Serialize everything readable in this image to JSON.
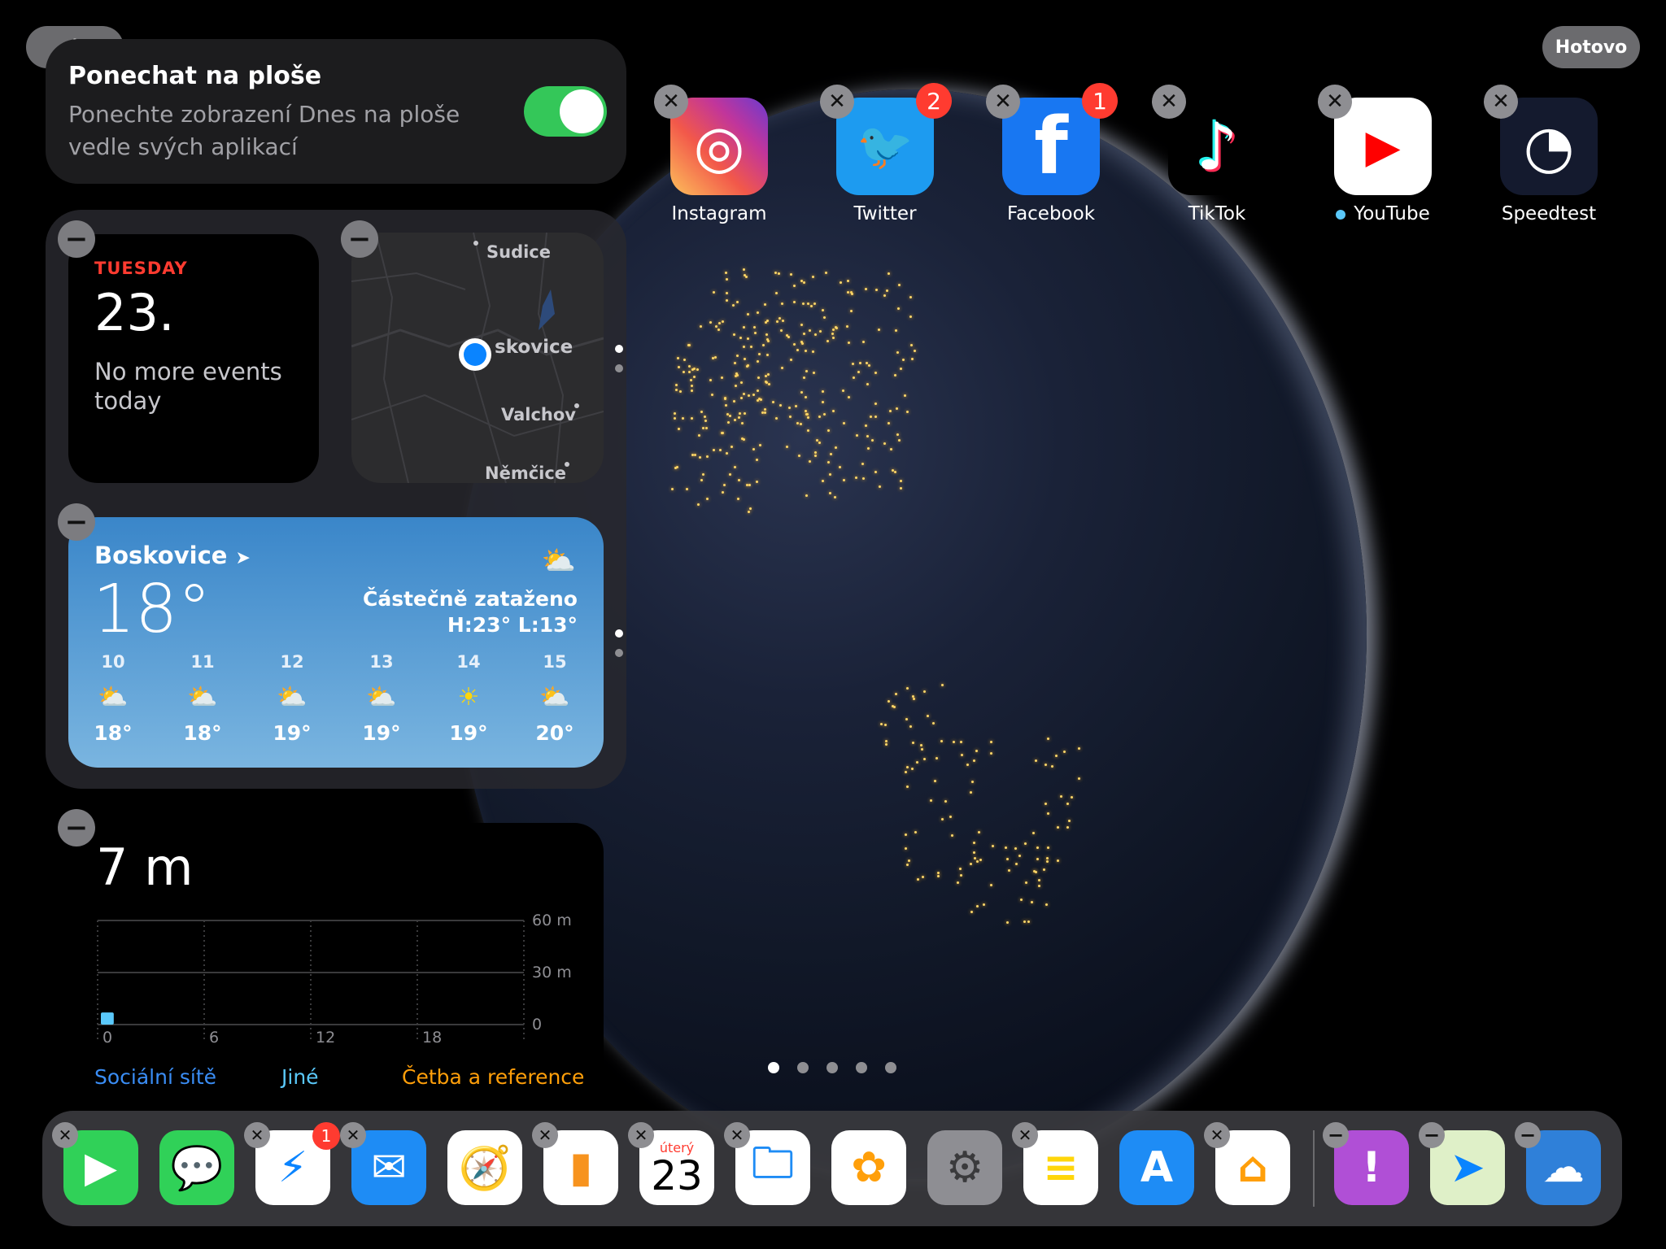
{
  "top": {
    "add_label": "+",
    "done_label": "Hotovo"
  },
  "keep": {
    "title": "Ponechat na ploše",
    "desc_line1": "Ponechte zobrazení Dnes na ploše",
    "desc_line2": "vedle svých aplikací",
    "toggle_on": true
  },
  "calendar": {
    "day": "TUESDAY",
    "date": "23.",
    "events_line1": "No more events",
    "events_line2": "today"
  },
  "map": {
    "places": [
      "Sudice",
      "skovice",
      "Valchov",
      "Němčice"
    ]
  },
  "weather": {
    "city": "Boskovice",
    "temp": "18°",
    "condition": "Částečně zataženo",
    "hilo": "H:23° L:13°",
    "hours": [
      {
        "h": "10",
        "t": "18°",
        "icon": "partly-cloudy-icon"
      },
      {
        "h": "11",
        "t": "18°",
        "icon": "partly-cloudy-icon"
      },
      {
        "h": "12",
        "t": "19°",
        "icon": "partly-cloudy-icon"
      },
      {
        "h": "13",
        "t": "19°",
        "icon": "partly-cloudy-icon"
      },
      {
        "h": "14",
        "t": "19°",
        "icon": "sun-icon"
      },
      {
        "h": "15",
        "t": "20°",
        "icon": "partly-cloudy-icon"
      }
    ]
  },
  "screentime": {
    "total": "7 m",
    "chart_data": {
      "type": "bar",
      "x_ticks": [
        "0",
        "6",
        "12",
        "18"
      ],
      "y_ticks": [
        "60 m",
        "30 m",
        "0"
      ],
      "ylim": [
        0,
        60
      ],
      "bars": [
        {
          "hour": 0,
          "value": 7
        }
      ]
    },
    "categories": [
      {
        "name": "Sociální sítě",
        "color": "#3a8df5"
      },
      {
        "name": "Jiné",
        "color": "#5ac8fa"
      },
      {
        "name": "Četba a reference",
        "color": "#ff9f0a"
      }
    ]
  },
  "apps": [
    {
      "name": "Instagram",
      "badge": "",
      "dot": false
    },
    {
      "name": "Twitter",
      "badge": "2",
      "dot": false
    },
    {
      "name": "Facebook",
      "badge": "1",
      "dot": false
    },
    {
      "name": "TikTok",
      "badge": "",
      "dot": false
    },
    {
      "name": "YouTube",
      "badge": "",
      "dot": true
    },
    {
      "name": "Speedtest",
      "badge": "",
      "dot": false
    }
  ],
  "dock": {
    "messenger_badge": "1",
    "calendar_day": "úterý",
    "calendar_date": "23",
    "items": [
      "facetime-icon",
      "messages-icon",
      "messenger-icon",
      "mail-icon",
      "safari-icon",
      "analytics-icon",
      "calendar-icon",
      "files-icon",
      "photos-icon",
      "settings-icon",
      "notes-icon",
      "appstore-icon",
      "home-icon",
      "feedback-icon",
      "maps-icon",
      "cloud-icon"
    ]
  },
  "colors": {
    "accent_green": "#34c759",
    "badge_red": "#ff3b30",
    "weather_top": "#3a86c9",
    "weather_bottom": "#7ab5e0"
  }
}
